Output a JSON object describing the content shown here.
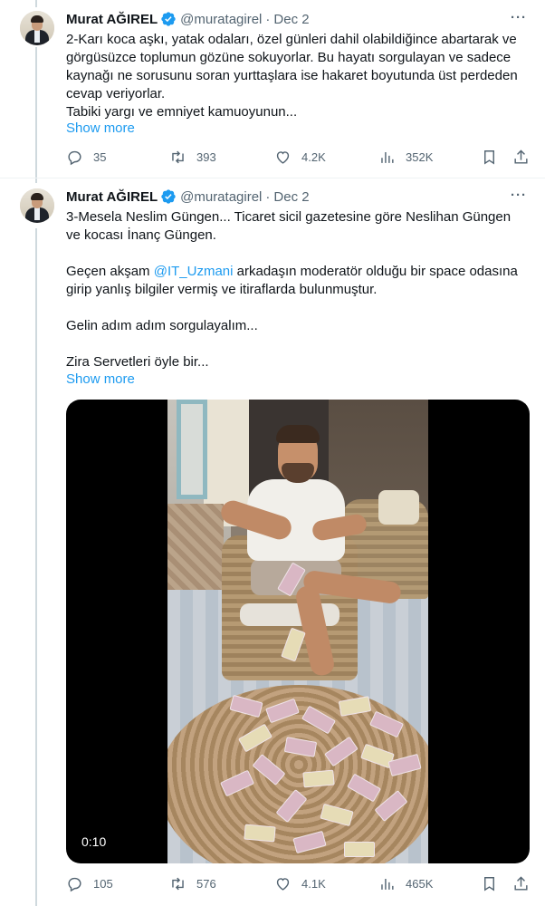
{
  "tweets": [
    {
      "author": {
        "name": "Murat AĞIREL",
        "handle": "@muratagirel",
        "separator": "·",
        "date": "Dec 2",
        "verified": true
      },
      "more_label": "···",
      "lines": [
        "2-Karı koca aşkı, yatak odaları, özel günleri dahil olabildiğince abartarak ve",
        "görgüsüzce toplumun gözüne sokuyorlar. Bu hayatı sorgulayan ve sadece",
        "kaynağı ne sorusunu soran yurttaşlara ise hakaret boyutunda üst perdeden",
        "cevap veriyorlar.",
        "Tabiki yargı ve emniyet kamuoyunun..."
      ],
      "show_more": "Show more",
      "stats": {
        "replies": "35",
        "reposts": "393",
        "likes": "4.2K",
        "views": "352K"
      }
    },
    {
      "author": {
        "name": "Murat AĞIREL",
        "handle": "@muratagirel",
        "separator": "·",
        "date": "Dec 2",
        "verified": true
      },
      "more_label": "···",
      "lines": [
        "3-Mesela Neslim Güngen... Ticaret sicil gazetesine göre Neslihan Güngen",
        "ve kocası İnanç Güngen."
      ],
      "para2_before": "Geçen akşam ",
      "para2_mention": "@IT_Uzmani",
      "para2_after": " arkadaşın moderatör olduğu bir space odasına",
      "para2_line2": "girip yanlış bilgiler vermiş ve itiraflarda bulunmuştur.",
      "para3": "Gelin adım adım sorgulayalım...",
      "para4": "Zira Servetleri öyle bir...",
      "show_more": "Show more",
      "video": {
        "timestamp": "0:10"
      },
      "stats": {
        "replies": "105",
        "reposts": "576",
        "likes": "4.1K",
        "views": "465K"
      }
    }
  ],
  "icons": [
    "reply-icon",
    "repost-icon",
    "like-icon",
    "views-icon",
    "bookmark-icon",
    "share-icon",
    "verified-badge-icon",
    "more-icon"
  ],
  "colors": {
    "link": "#1d9bf0",
    "muted": "#536471",
    "text": "#0f1419",
    "thread_line": "#cfd9de"
  }
}
